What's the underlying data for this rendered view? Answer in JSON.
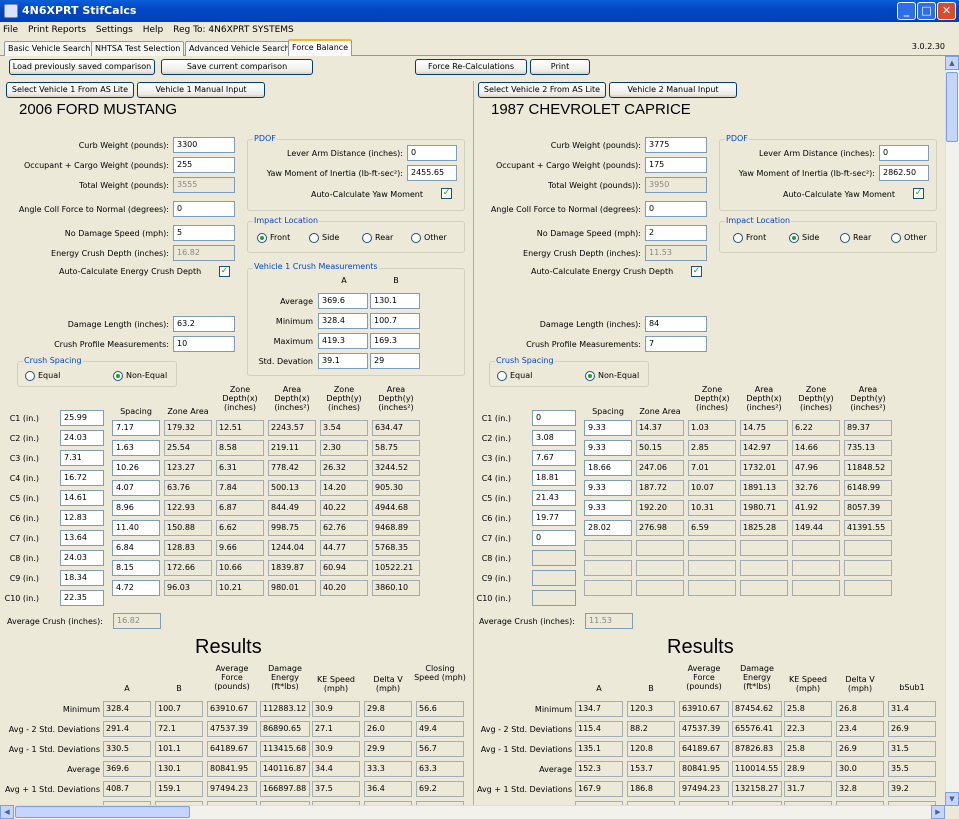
{
  "window": {
    "title": "4N6XPRT StifCalcs",
    "version": "3.0.2.30"
  },
  "menu": [
    "File",
    "Print Reports",
    "Settings",
    "Help",
    "Reg To: 4N6XPRT SYSTEMS"
  ],
  "tabs": [
    "Basic Vehicle Search",
    "NHTSA Test Selection",
    "Advanced Vehicle Search",
    "Force Balance"
  ],
  "toolbar": {
    "load": "Load previously saved comparison",
    "save": "Save current comparison",
    "recalc": "Force Re-Calculations",
    "print": "Print"
  },
  "labels": {
    "curb": "Curb Weight (pounds):",
    "occ": "Occupant + Cargo Weight (pounds):",
    "total": "Total Weight (pounds):",
    "total2": "Total Weight (pounds)):",
    "angle": "Angle Coll Force to Normal (degrees):",
    "nodmg": "No Damage Speed (mph):",
    "ecd": "Energy Crush Depth (inches):",
    "autoecd": "Auto-Calculate Energy Crush Depth",
    "pdof": "PDOF",
    "lever": "Lever Arm Distance (inches):",
    "yaw": "Yaw Moment of Inertia (lb-ft-sec²):",
    "autoyaw": "Auto-Calculate Yaw Moment",
    "impact": "Impact Location",
    "front": "Front",
    "side": "Side",
    "rear": "Rear",
    "other": "Other",
    "crushmeas": "Vehicle 1 Crush Measurements",
    "colA": "A",
    "colB": "B",
    "average": "Average",
    "minimum": "Minimum",
    "maximum": "Maximum",
    "stddev": "Std. Devation",
    "dmglen": "Damage Length (inches):",
    "profile": "Crush Profile Measurements:",
    "spacing_grp": "Crush Spacing",
    "equal": "Equal",
    "nonequal": "Non-Equal",
    "h_spacing": "Spacing",
    "h_zarea": "Zone Area",
    "h_zdx": "Zone Depth(x) (inches)",
    "h_adx": "Area Depth(x) (inches²)",
    "h_zdy": "Zone Depth(y) (inches)",
    "h_ady": "Area Depth(y) (inches²)",
    "avgcrush": "Average Crush (inches):",
    "results": "Results",
    "r_a": "A",
    "r_b": "B",
    "r_force": "Average Force (pounds)",
    "r_energy": "Damage Energy (ft*lbs)",
    "r_ke": "KE Speed (mph)",
    "r_dv": "Delta V (mph)",
    "r_closing": "Closing Speed (mph)",
    "r_bsub": "bSub1",
    "rows": [
      "Minimum",
      "Avg - 2 Std. Deviations",
      "Avg - 1 Std. Deviations",
      "Average",
      "Avg + 1 Std. Deviations"
    ]
  },
  "c_labels": [
    "C1 (in.)",
    "C2 (in.)",
    "C3 (in.)",
    "C4 (in.)",
    "C5 (in.)",
    "C6 (in.)",
    "C7 (in.)",
    "C8 (in.)",
    "C9 (in.)",
    "C10 (in.)"
  ],
  "v1": {
    "select_btn": "Select Vehicle 1 From AS Lite",
    "manual_btn": "Vehicle 1 Manual Input",
    "name": "2006 FORD MUSTANG",
    "curb": "3300",
    "occ": "255",
    "total": "3555",
    "angle": "0",
    "nodmg": "5",
    "ecd": "16.82",
    "lever": "0",
    "yaw": "2455.65",
    "stats": {
      "avg": [
        "369.6",
        "130.1"
      ],
      "min": [
        "328.4",
        "100.7"
      ],
      "max": [
        "419.3",
        "169.3"
      ],
      "std": [
        "39.1",
        "29"
      ]
    },
    "dmglen": "63.2",
    "profile": "10",
    "c": [
      "25.99",
      "24.03",
      "7.31",
      "16.72",
      "14.61",
      "12.83",
      "13.64",
      "24.03",
      "18.34",
      "22.35"
    ],
    "zones": [
      [
        "7.17",
        "179.32",
        "12.51",
        "2243.57",
        "3.54",
        "634.47"
      ],
      [
        "1.63",
        "25.54",
        "8.58",
        "219.11",
        "2.30",
        "58.75"
      ],
      [
        "10.26",
        "123.27",
        "6.31",
        "778.42",
        "26.32",
        "3244.52"
      ],
      [
        "4.07",
        "63.76",
        "7.84",
        "500.13",
        "14.20",
        "905.30"
      ],
      [
        "8.96",
        "122.93",
        "6.87",
        "844.49",
        "40.22",
        "4944.68"
      ],
      [
        "11.40",
        "150.88",
        "6.62",
        "998.75",
        "62.76",
        "9468.89"
      ],
      [
        "6.84",
        "128.83",
        "9.66",
        "1244.04",
        "44.77",
        "5768.35"
      ],
      [
        "8.15",
        "172.66",
        "10.66",
        "1839.87",
        "60.94",
        "10522.21"
      ],
      [
        "4.72",
        "96.03",
        "10.21",
        "980.01",
        "40.20",
        "3860.10"
      ]
    ],
    "avgcrush": "16.82",
    "results": [
      [
        "328.4",
        "100.7",
        "63910.67",
        "112883.12",
        "30.9",
        "29.8",
        "56.6"
      ],
      [
        "291.4",
        "72.1",
        "47537.39",
        "86890.65",
        "27.1",
        "26.0",
        "49.4"
      ],
      [
        "330.5",
        "101.1",
        "64189.67",
        "113415.68",
        "30.9",
        "29.9",
        "56.7"
      ],
      [
        "369.6",
        "130.1",
        "80841.95",
        "140116.87",
        "34.4",
        "33.3",
        "63.3"
      ],
      [
        "408.7",
        "159.1",
        "97494.23",
        "166897.88",
        "37.5",
        "36.4",
        "69.2"
      ]
    ]
  },
  "v2": {
    "select_btn": "Select Vehicle 2 From AS Lite",
    "manual_btn": "Vehicle 2 Manual Input",
    "name": "1987 CHEVROLET CAPRICE",
    "curb": "3775",
    "occ": "175",
    "total": "3950",
    "angle": "0",
    "nodmg": "2",
    "ecd": "11.53",
    "lever": "0",
    "yaw": "2862.50",
    "dmglen": "84",
    "profile": "7",
    "c": [
      "0",
      "3.08",
      "7.67",
      "18.81",
      "21.43",
      "19.77",
      "0",
      "",
      "",
      ""
    ],
    "zones": [
      [
        "9.33",
        "14.37",
        "1.03",
        "14.75",
        "6.22",
        "89.37"
      ],
      [
        "9.33",
        "50.15",
        "2.85",
        "142.97",
        "14.66",
        "735.13"
      ],
      [
        "18.66",
        "247.06",
        "7.01",
        "1732.01",
        "47.96",
        "11848.52"
      ],
      [
        "9.33",
        "187.72",
        "10.07",
        "1891.13",
        "32.76",
        "6148.99"
      ],
      [
        "9.33",
        "192.20",
        "10.31",
        "1980.71",
        "41.92",
        "8057.39"
      ],
      [
        "28.02",
        "276.98",
        "6.59",
        "1825.28",
        "149.44",
        "41391.55"
      ],
      [
        "",
        "",
        "",
        "",
        "",
        ""
      ],
      [
        "",
        "",
        "",
        "",
        "",
        ""
      ],
      [
        "",
        "",
        "",
        "",
        "",
        ""
      ]
    ],
    "avgcrush": "11.53",
    "results": [
      [
        "134.7",
        "120.3",
        "63910.67",
        "87454.62",
        "25.8",
        "26.8",
        "31.4"
      ],
      [
        "115.4",
        "88.2",
        "47537.39",
        "65576.41",
        "22.3",
        "23.4",
        "26.9"
      ],
      [
        "135.1",
        "120.8",
        "64189.67",
        "87826.83",
        "25.8",
        "26.9",
        "31.5"
      ],
      [
        "152.3",
        "153.7",
        "80841.95",
        "110014.55",
        "28.9",
        "30.0",
        "35.5"
      ],
      [
        "167.9",
        "186.8",
        "97494.23",
        "132158.27",
        "31.7",
        "32.8",
        "39.2"
      ]
    ]
  }
}
